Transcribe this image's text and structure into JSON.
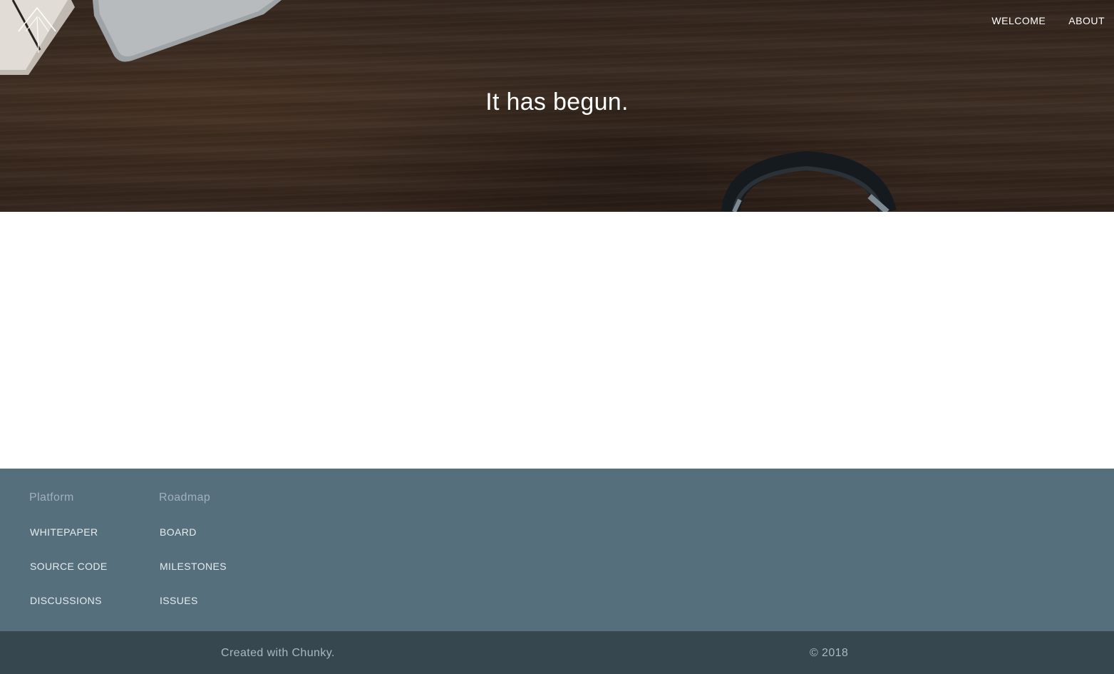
{
  "header": {
    "logo_icon": "mountain-peak-icon",
    "nav": [
      {
        "label": "WELCOME"
      },
      {
        "label": "ABOUT"
      }
    ]
  },
  "hero": {
    "title": "It has begun."
  },
  "footer": {
    "columns": [
      {
        "heading": "Platform",
        "links": [
          "WHITEPAPER",
          "SOURCE CODE",
          "DISCUSSIONS"
        ]
      },
      {
        "heading": "Roadmap",
        "links": [
          "BOARD",
          "MILESTONES",
          "ISSUES"
        ]
      }
    ],
    "credit": "Created with Chunky.",
    "copyright": "© 2018"
  },
  "colors": {
    "footer_top": "#566f7c",
    "footer_bottom": "#37474f",
    "hero_wood": "#4a3629"
  }
}
